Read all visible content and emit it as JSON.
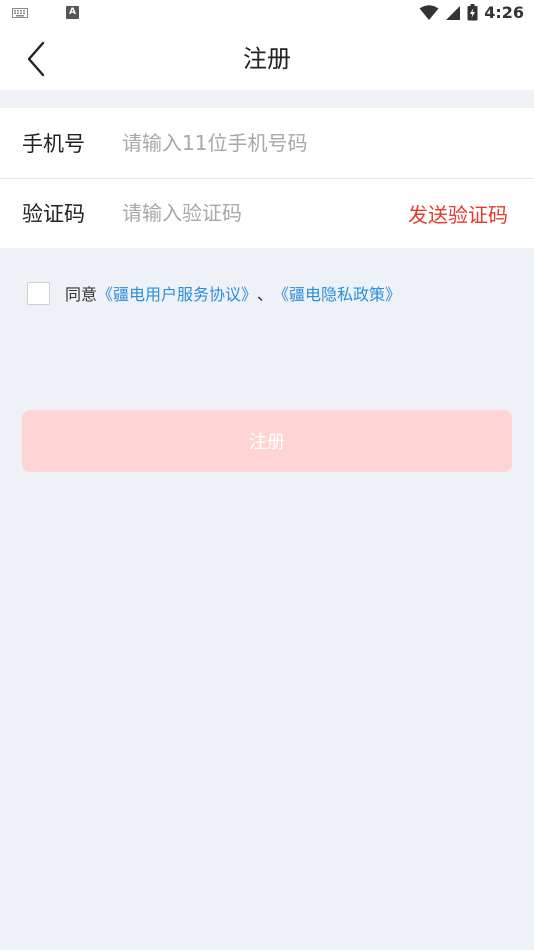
{
  "status_bar": {
    "time": "4:26",
    "left_icons": [
      "keyboard-icon",
      "a-badge-icon"
    ],
    "left_badge_text": "A",
    "right_icons": [
      "wifi-icon",
      "cell-signal-icon",
      "battery-charging-icon"
    ]
  },
  "nav": {
    "title": "注册",
    "back_icon": "chevron-left-icon"
  },
  "form": {
    "phone": {
      "label": "手机号",
      "placeholder": "请输入11位手机号码",
      "value": ""
    },
    "code": {
      "label": "验证码",
      "placeholder": "请输入验证码",
      "value": "",
      "send_label": "发送验证码"
    }
  },
  "agreement": {
    "checked": false,
    "prefix": "同意",
    "link_terms": "《疆电用户服务协议》",
    "separator": "、",
    "link_privacy": "《疆电隐私政策》"
  },
  "register": {
    "label": "注册"
  },
  "colors": {
    "accent_red": "#e8382f",
    "link_blue": "#2a8fe0",
    "button_disabled": "#ffd4d4",
    "page_bg": "#eef1f5"
  }
}
